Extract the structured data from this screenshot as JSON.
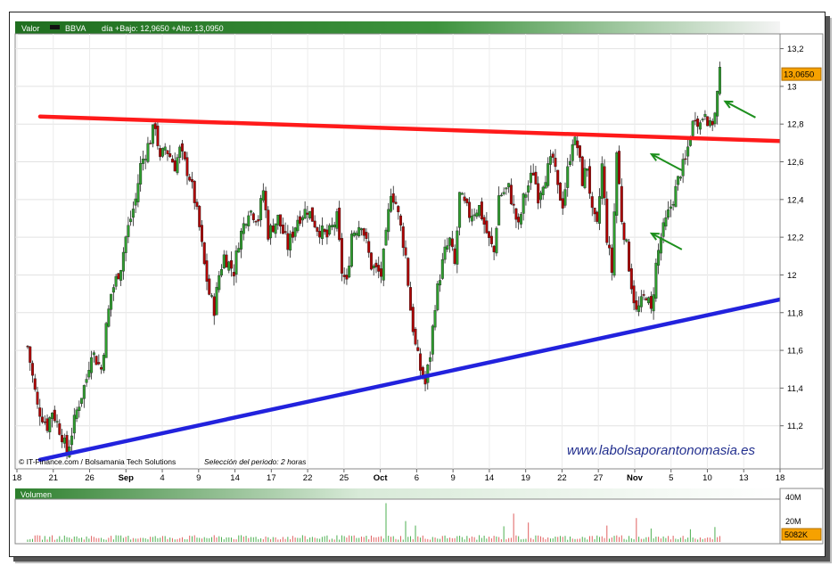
{
  "header": {
    "valor_label": "Valor",
    "ticker": "BBVA",
    "quote_text": "día +Bajo: 12,9650 +Alto: 13,0950"
  },
  "chart_data": {
    "type": "candlestick",
    "title": "",
    "x_tick_labels": [
      "18",
      "21",
      "26",
      "Sep",
      "4",
      "9",
      "14",
      "17",
      "22",
      "25",
      "Oct",
      "6",
      "9",
      "14",
      "19",
      "22",
      "27",
      "Nov",
      "5",
      "10",
      "13",
      "18"
    ],
    "bold_month_labels": [
      "Sep",
      "Oct",
      "Nov"
    ],
    "y_tick_labels": [
      "11,2",
      "11,4",
      "11,6",
      "11,8",
      "12",
      "12,2",
      "12,4",
      "12,6",
      "12,8",
      "13",
      "13,2"
    ],
    "ylim": [
      11.0,
      13.25
    ],
    "last_price_label": "13,0650",
    "last_price": 13.065,
    "price_path": [
      [
        0,
        11.62
      ],
      [
        2,
        11.3
      ],
      [
        4,
        11.2
      ],
      [
        5,
        11.28
      ],
      [
        7,
        11.15
      ],
      [
        8,
        11.05
      ],
      [
        10,
        11.28
      ],
      [
        12,
        11.45
      ],
      [
        13,
        11.6
      ],
      [
        15,
        11.5
      ],
      [
        16,
        11.72
      ],
      [
        17,
        11.9
      ],
      [
        19,
        12.05
      ],
      [
        20,
        12.2
      ],
      [
        22,
        12.4
      ],
      [
        23,
        12.58
      ],
      [
        25,
        12.72
      ],
      [
        26,
        12.8
      ],
      [
        27,
        12.6
      ],
      [
        28,
        12.68
      ],
      [
        30,
        12.58
      ],
      [
        31,
        12.66
      ],
      [
        33,
        12.52
      ],
      [
        34,
        12.4
      ],
      [
        35,
        12.25
      ],
      [
        36,
        12.05
      ],
      [
        37,
        11.9
      ],
      [
        38,
        11.82
      ],
      [
        39,
        12.0
      ],
      [
        40,
        12.1
      ],
      [
        42,
        12.02
      ],
      [
        43,
        12.18
      ],
      [
        45,
        12.35
      ],
      [
        47,
        12.3
      ],
      [
        48,
        12.45
      ],
      [
        49,
        12.22
      ],
      [
        51,
        12.3
      ],
      [
        53,
        12.15
      ],
      [
        55,
        12.3
      ],
      [
        57,
        12.35
      ],
      [
        59,
        12.25
      ],
      [
        61,
        12.2
      ],
      [
        63,
        12.3
      ],
      [
        64,
        12.02
      ],
      [
        65,
        11.95
      ],
      [
        66,
        12.22
      ],
      [
        68,
        12.28
      ],
      [
        70,
        12.05
      ],
      [
        72,
        12.0
      ],
      [
        73,
        12.2
      ],
      [
        74,
        12.45
      ],
      [
        75,
        12.38
      ],
      [
        76,
        12.25
      ],
      [
        77,
        12.1
      ],
      [
        78,
        11.82
      ],
      [
        79,
        11.62
      ],
      [
        80,
        11.5
      ],
      [
        81,
        11.42
      ],
      [
        82,
        11.58
      ],
      [
        83,
        11.85
      ],
      [
        84,
        12.0
      ],
      [
        85,
        12.12
      ],
      [
        86,
        12.18
      ],
      [
        87,
        12.05
      ],
      [
        88,
        12.42
      ],
      [
        90,
        12.32
      ],
      [
        92,
        12.36
      ],
      [
        94,
        12.18
      ],
      [
        95,
        12.12
      ],
      [
        96,
        12.42
      ],
      [
        98,
        12.46
      ],
      [
        99,
        12.35
      ],
      [
        100,
        12.25
      ],
      [
        101,
        12.4
      ],
      [
        103,
        12.55
      ],
      [
        104,
        12.42
      ],
      [
        105,
        12.5
      ],
      [
        107,
        12.62
      ],
      [
        108,
        12.45
      ],
      [
        109,
        12.38
      ],
      [
        110,
        12.55
      ],
      [
        111,
        12.72
      ],
      [
        112,
        12.68
      ],
      [
        113,
        12.5
      ],
      [
        114,
        12.58
      ],
      [
        115,
        12.32
      ],
      [
        116,
        12.25
      ],
      [
        117,
        12.58
      ],
      [
        118,
        12.2
      ],
      [
        119,
        12.02
      ],
      [
        120,
        12.65
      ],
      [
        121,
        12.3
      ],
      [
        122,
        12.15
      ],
      [
        123,
        11.95
      ],
      [
        124,
        11.8
      ],
      [
        125,
        11.85
      ],
      [
        126,
        11.9
      ],
      [
        127,
        11.8
      ],
      [
        128,
        12.05
      ],
      [
        129,
        12.2
      ],
      [
        130,
        12.28
      ],
      [
        132,
        12.45
      ],
      [
        133,
        12.55
      ],
      [
        134,
        12.6
      ],
      [
        135,
        12.75
      ],
      [
        136,
        12.85
      ],
      [
        137,
        12.8
      ],
      [
        138,
        12.88
      ],
      [
        139,
        12.78
      ],
      [
        140,
        12.85
      ],
      [
        141,
        13.065
      ]
    ],
    "trendlines": [
      {
        "name": "resistance",
        "color": "#ff1a1a",
        "points": [
          [
            0,
            12.84
          ],
          [
            150,
            12.71
          ]
        ]
      },
      {
        "name": "support",
        "color": "#2222dd",
        "points": [
          [
            0,
            11.02
          ],
          [
            150,
            11.87
          ]
        ]
      }
    ],
    "annotations": [
      {
        "type": "arrow",
        "color": "#1d8f1d",
        "point_to": [
          126,
          12.22
        ]
      },
      {
        "type": "arrow",
        "color": "#1d8f1d",
        "point_to": [
          126,
          12.64
        ]
      },
      {
        "type": "arrow",
        "color": "#1d8f1d",
        "point_to": [
          141,
          12.92
        ]
      }
    ],
    "volume": {
      "label": "Volumen",
      "y_tick_labels": [
        "40M",
        "20M"
      ],
      "last_volume_label": "5082K",
      "spikes": [
        {
          "x": 73,
          "value": 52
        },
        {
          "x": 77,
          "value": 28
        },
        {
          "x": 79,
          "value": 22
        },
        {
          "x": 97,
          "value": 21
        },
        {
          "x": 99,
          "value": 38
        },
        {
          "x": 102,
          "value": 26
        },
        {
          "x": 118,
          "value": 22
        },
        {
          "x": 124,
          "value": 32
        },
        {
          "x": 127,
          "value": 18
        },
        {
          "x": 135,
          "value": 17
        },
        {
          "x": 140,
          "value": 20
        }
      ],
      "base_level": 7
    }
  },
  "footer": {
    "credit": "© IT-Finance.com / Bolsamania Tech Solutions",
    "period": "Selección del periodo: 2 horas",
    "website": "www.labolsaporantonomasia.es"
  },
  "colors": {
    "header_bar": "#3a8a3a",
    "candle_up": "#2e9e2e",
    "candle_down": "#b00000",
    "volume_bar": "#e06060",
    "volume_bar_alt": "#4caf50",
    "website_text": "#23308f"
  }
}
